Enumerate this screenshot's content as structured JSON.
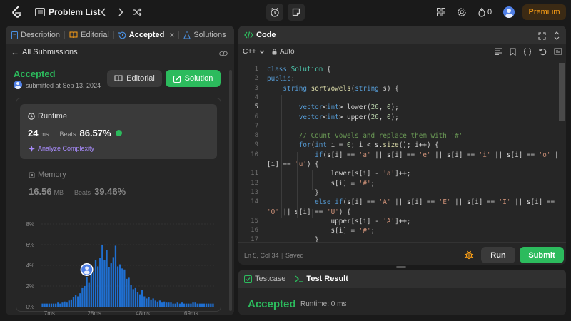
{
  "topbar": {
    "title": "Problem List",
    "streak_count": "0",
    "premium_label": "Premium"
  },
  "left_panel": {
    "tabs": [
      {
        "label": "Description"
      },
      {
        "label": "Editorial"
      },
      {
        "label": "Accepted"
      },
      {
        "label": "Solutions"
      }
    ],
    "back_label": "All Submissions",
    "status": "Accepted",
    "submitted_text": "submitted at Sep 13, 2024",
    "editorial_button": "Editorial",
    "solution_button": "Solution",
    "runtime": {
      "label": "Runtime",
      "value": "24",
      "unit": "ms",
      "beats_label": "Beats",
      "beats_value": "86.57%",
      "analyze_label": "Analyze Complexity"
    },
    "memory": {
      "label": "Memory",
      "value": "16.56",
      "unit": "MB",
      "beats_label": "Beats",
      "beats_value": "39.46%"
    }
  },
  "chart_data": {
    "type": "bar",
    "y_ticks": [
      "8%",
      "6%",
      "4%",
      "2%",
      "0%"
    ],
    "ylim": [
      0,
      8
    ],
    "x_ticks": [
      "7ms",
      "28ms",
      "48ms",
      "69ms"
    ],
    "highlight_index": 20,
    "values": [
      0.3,
      0.3,
      0.3,
      0.3,
      0.3,
      0.3,
      0.3,
      0.4,
      0.3,
      0.4,
      0.5,
      0.4,
      0.6,
      0.7,
      0.9,
      1.1,
      1.0,
      1.3,
      1.8,
      2.0,
      2.9,
      2.3,
      3.5,
      3.3,
      4.5,
      3.9,
      4.7,
      6.0,
      4.5,
      5.5,
      3.8,
      4.2,
      4.8,
      5.9,
      3.9,
      4.1,
      3.7,
      3.6,
      2.7,
      2.8,
      2.1,
      1.7,
      1.8,
      1.4,
      1.2,
      1.6,
      1.0,
      0.8,
      0.9,
      0.7,
      0.8,
      0.6,
      0.5,
      0.6,
      0.4,
      0.5,
      0.4,
      0.4,
      0.4,
      0.3,
      0.3,
      0.4,
      0.3,
      0.4,
      0.3,
      0.3,
      0.3,
      0.3,
      0.4,
      0.4,
      0.3,
      0.3,
      0.3,
      0.3,
      0.3,
      0.3,
      0.3,
      0.3
    ]
  },
  "code_panel": {
    "title": "Code",
    "language": "C++",
    "mode": "Auto",
    "status_position": "Ln 5, Col 34",
    "status_saved": "Saved",
    "run_label": "Run",
    "submit_label": "Submit",
    "lines": [
      {
        "n": "1",
        "text": "class Solution {"
      },
      {
        "n": "2",
        "text": "public:"
      },
      {
        "n": "3",
        "text": "    string sortVowels(string s) {"
      },
      {
        "n": "4",
        "text": ""
      },
      {
        "n": "5",
        "text": "        vector<int> lower(26, 0);"
      },
      {
        "n": "6",
        "text": "        vector<int> upper(26, 0);"
      },
      {
        "n": "7",
        "text": ""
      },
      {
        "n": "8",
        "text": "        // Count vowels and replace them with '#'"
      },
      {
        "n": "9",
        "text": "        for(int i = 0; i < s.size(); i++) {"
      },
      {
        "n": "10",
        "text": "            if(s[i] == 'a' || s[i] == 'e' || s[i] == 'i' || s[i] == 'o' || s"
      },
      {
        "n": "",
        "text": "[i] == 'u') {"
      },
      {
        "n": "11",
        "text": "                lower[s[i] - 'a']++;"
      },
      {
        "n": "12",
        "text": "                s[i] = '#';"
      },
      {
        "n": "13",
        "text": "            }"
      },
      {
        "n": "14",
        "text": "            else if(s[i] == 'A' || s[i] == 'E' || s[i] == 'I' || s[i] =="
      },
      {
        "n": "",
        "text": "'O' || s[i] == 'U') {"
      },
      {
        "n": "15",
        "text": "                upper[s[i] - 'A']++;"
      },
      {
        "n": "16",
        "text": "                s[i] = '#';"
      },
      {
        "n": "17",
        "text": "            }"
      }
    ]
  },
  "test_panel": {
    "tab_testcase": "Testcase",
    "tab_result": "Test Result",
    "status": "Accepted",
    "runtime_text": "Runtime: 0 ms"
  },
  "colors": {
    "accent_green": "#2cbb5d",
    "bar_blue": "#1f6fd1",
    "premium_orange": "#ffa116"
  }
}
